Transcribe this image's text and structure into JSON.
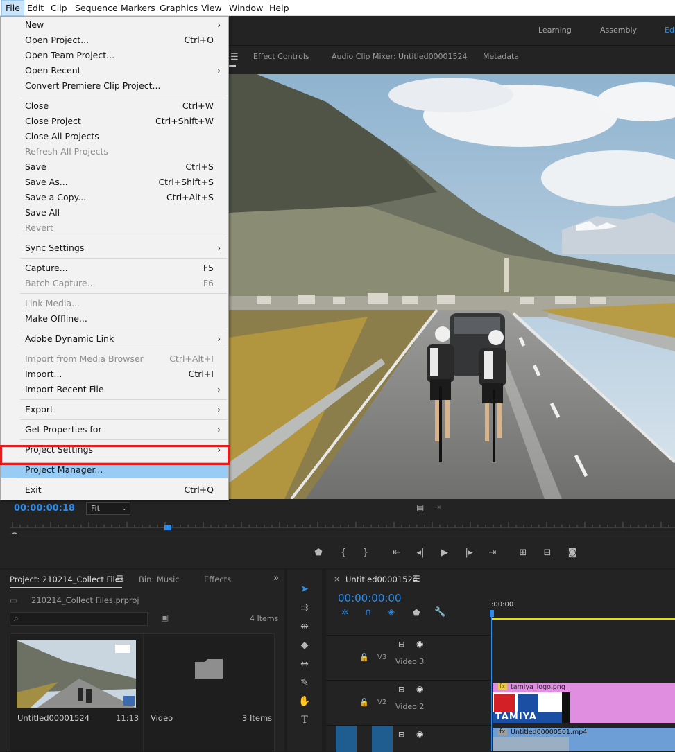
{
  "menubar": {
    "items": [
      "File",
      "Edit",
      "Clip",
      "Sequence",
      "Markers",
      "Graphics",
      "View",
      "Window",
      "Help"
    ]
  },
  "file_menu": {
    "items": [
      {
        "label": "New",
        "arrow": true
      },
      {
        "label": "Open Project...",
        "shortcut": "Ctrl+O"
      },
      {
        "label": "Open Team Project..."
      },
      {
        "label": "Open Recent",
        "arrow": true
      },
      {
        "label": "Convert Premiere Clip Project..."
      },
      {
        "sep": true
      },
      {
        "label": "Close",
        "shortcut": "Ctrl+W"
      },
      {
        "label": "Close Project",
        "shortcut": "Ctrl+Shift+W"
      },
      {
        "label": "Close All Projects"
      },
      {
        "label": "Refresh All Projects",
        "disabled": true
      },
      {
        "label": "Save",
        "shortcut": "Ctrl+S"
      },
      {
        "label": "Save As...",
        "shortcut": "Ctrl+Shift+S"
      },
      {
        "label": "Save a Copy...",
        "shortcut": "Ctrl+Alt+S"
      },
      {
        "label": "Save All"
      },
      {
        "label": "Revert",
        "disabled": true
      },
      {
        "sep": true
      },
      {
        "label": "Sync Settings",
        "arrow": true
      },
      {
        "sep": true
      },
      {
        "label": "Capture...",
        "shortcut": "F5"
      },
      {
        "label": "Batch Capture...",
        "shortcut": "F6",
        "disabled": true
      },
      {
        "sep": true
      },
      {
        "label": "Link Media...",
        "disabled": true
      },
      {
        "label": "Make Offline..."
      },
      {
        "sep": true
      },
      {
        "label": "Adobe Dynamic Link",
        "arrow": true
      },
      {
        "sep": true
      },
      {
        "label": "Import from Media Browser",
        "shortcut": "Ctrl+Alt+I",
        "disabled": true
      },
      {
        "label": "Import...",
        "shortcut": "Ctrl+I"
      },
      {
        "label": "Import Recent File",
        "arrow": true
      },
      {
        "sep": true
      },
      {
        "label": "Export",
        "arrow": true
      },
      {
        "sep": true
      },
      {
        "label": "Get Properties for",
        "arrow": true
      },
      {
        "sep": true
      },
      {
        "label": "Project Settings",
        "arrow": true
      },
      {
        "sep": true
      },
      {
        "label": "Project Manager...",
        "highlighted": true
      },
      {
        "sep": true
      },
      {
        "label": "Exit",
        "shortcut": "Ctrl+Q"
      }
    ]
  },
  "workspaces": {
    "learning": "Learning",
    "assembly": "Assembly",
    "editing": "Edi"
  },
  "panel_tabs": {
    "effect_controls": "Effect Controls",
    "audio_mixer": "Audio Clip Mixer: Untitled00001524",
    "metadata": "Metadata"
  },
  "monitor": {
    "timecode": "00:00:00:18",
    "fit": "Fit"
  },
  "project": {
    "tab": "Project: 210214_Collect Files",
    "bin_tab": "Bin: Music",
    "effects_tab": "Effects",
    "file": "210214_Collect Files.prproj",
    "items_count": "4 Items",
    "items": [
      {
        "name": "Untitled00001524",
        "duration": "11:13"
      },
      {
        "name": "Video",
        "count": "3 Items"
      }
    ]
  },
  "timeline": {
    "tab": "Untitled00001524",
    "timecode": "00:00:00:00",
    "ruler_start": ":00:00",
    "tracks": [
      {
        "id": "V3",
        "name": "Video 3"
      },
      {
        "id": "V2",
        "name": "Video 2"
      }
    ],
    "clips": {
      "logo": "tamiya_logo.png",
      "video": "Untitled00000501.mp4",
      "logo_text": "TAMIYA"
    }
  },
  "colors": {
    "accent": "#2d8ceb",
    "highlight_border": "#e21d1d",
    "menu_highlight": "#99ccf5",
    "clip_pink": "#e08ee0",
    "clip_blue": "#6e9ed6"
  }
}
